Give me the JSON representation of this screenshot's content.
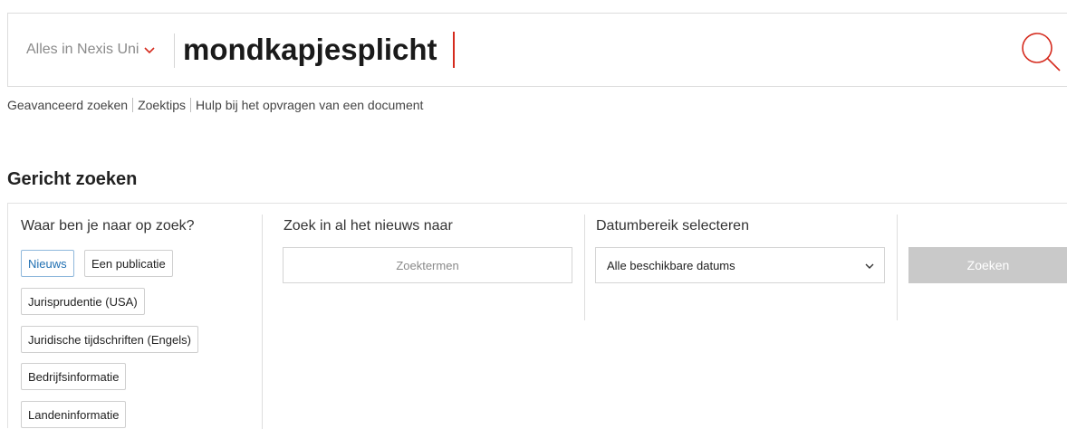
{
  "search": {
    "scope_label": "Alles in Nexis Uni",
    "query": "mondkapjesplicht"
  },
  "links": [
    "Geavanceerd zoeken",
    "Zoektips",
    "Hulp bij het opvragen van een document"
  ],
  "targeted": {
    "heading": "Gericht zoeken",
    "what_label": "Waar ben je naar op zoek?",
    "chips": [
      {
        "label": "Nieuws",
        "selected": true
      },
      {
        "label": "Een publicatie",
        "selected": false
      },
      {
        "label": "Jurisprudentie (USA)",
        "selected": false
      },
      {
        "label": "Juridische tijdschriften (Engels)",
        "selected": false
      },
      {
        "label": "Bedrijfsinformatie",
        "selected": false
      },
      {
        "label": "Landeninformatie",
        "selected": false
      }
    ],
    "terms_label": "Zoek in al het nieuws naar",
    "terms_placeholder": "Zoektermen",
    "date_label": "Datumbereik selecteren",
    "date_value": "Alle beschikbare datums",
    "submit_label": "Zoeken"
  },
  "colors": {
    "accent_red": "#d52b1e",
    "selected_blue": "#1f6fb2",
    "button_disabled": "#c9c9c9"
  }
}
